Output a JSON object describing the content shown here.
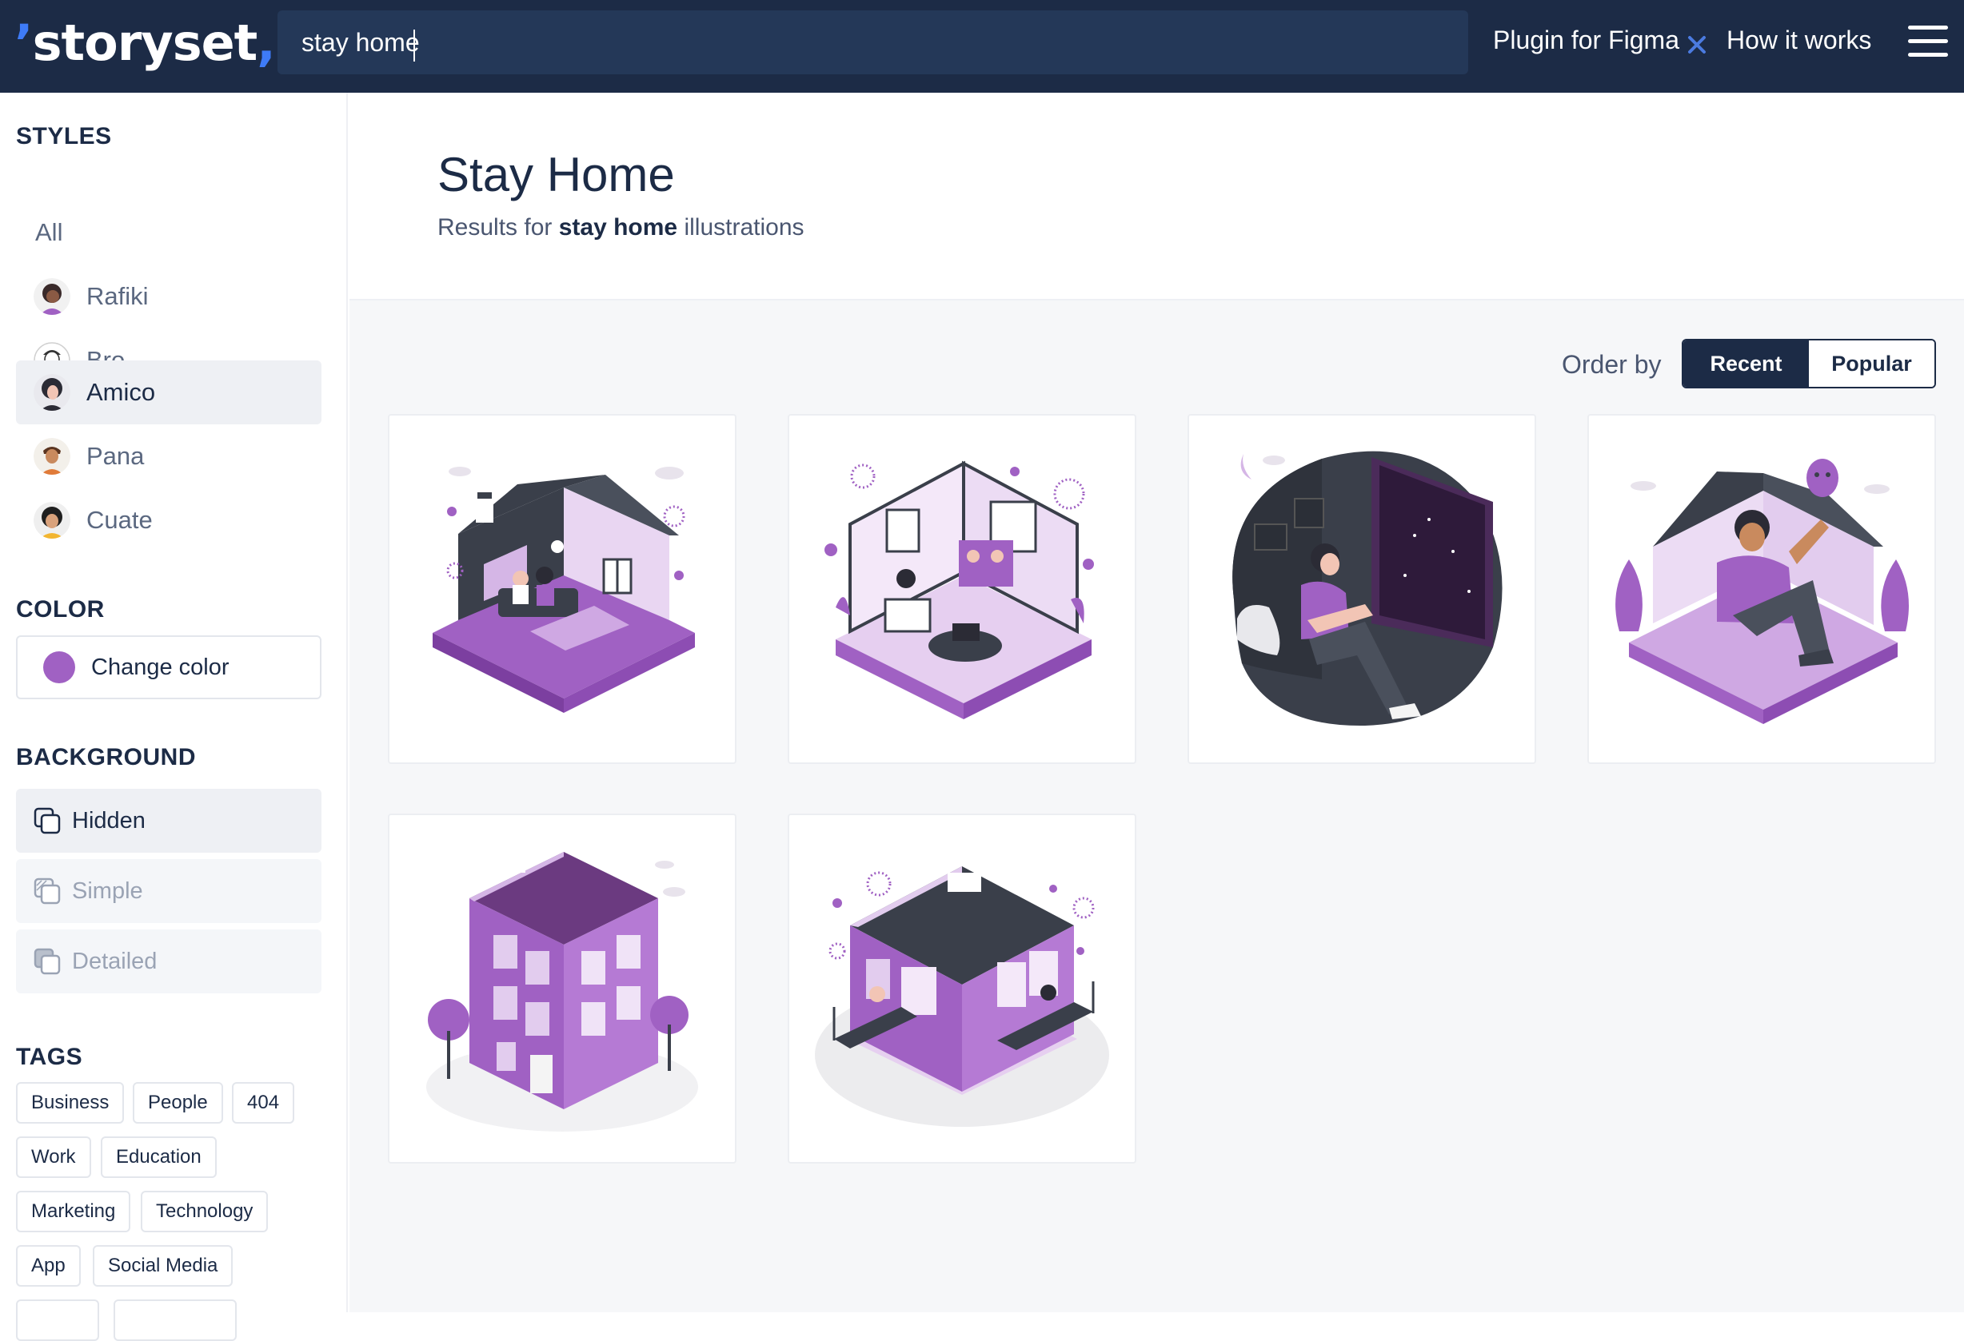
{
  "header": {
    "logo": "storyset",
    "search_value": "stay home",
    "nav": [
      "Plugin for Figma",
      "How it works"
    ]
  },
  "sidebar": {
    "styles_title": "STYLES",
    "styles": [
      {
        "label": "All"
      },
      {
        "label": "Rafiki"
      },
      {
        "label": "Bro"
      },
      {
        "label": "Amico",
        "active": true
      },
      {
        "label": "Pana"
      },
      {
        "label": "Cuate"
      }
    ],
    "color_title": "COLOR",
    "color_button": "Change color",
    "color_value": "#a061c3",
    "background_title": "BACKGROUND",
    "backgrounds": [
      "Hidden",
      "Simple",
      "Detailed"
    ],
    "tags_title": "TAGS",
    "tags": [
      "Business",
      "People",
      "404",
      "Work",
      "Education",
      "Marketing",
      "Technology",
      "App",
      "Social Media"
    ]
  },
  "main": {
    "title": "Stay Home",
    "subtitle_prefix": "Results for ",
    "subtitle_query": "stay home",
    "subtitle_suffix": " illustrations",
    "order_label": "Order by",
    "order_options": [
      "Recent",
      "Popular"
    ],
    "illustrations": [
      {
        "icon": "house-family-illustration"
      },
      {
        "icon": "room-video-call-illustration"
      },
      {
        "icon": "window-night-illustration"
      },
      {
        "icon": "man-in-house-illustration"
      },
      {
        "icon": "apartment-building-illustration"
      },
      {
        "icon": "house-balcony-illustration"
      }
    ]
  },
  "colors": {
    "header_bg": "#1c2b46",
    "accent": "#a061c3",
    "brand_blue": "#3e7bf7"
  }
}
